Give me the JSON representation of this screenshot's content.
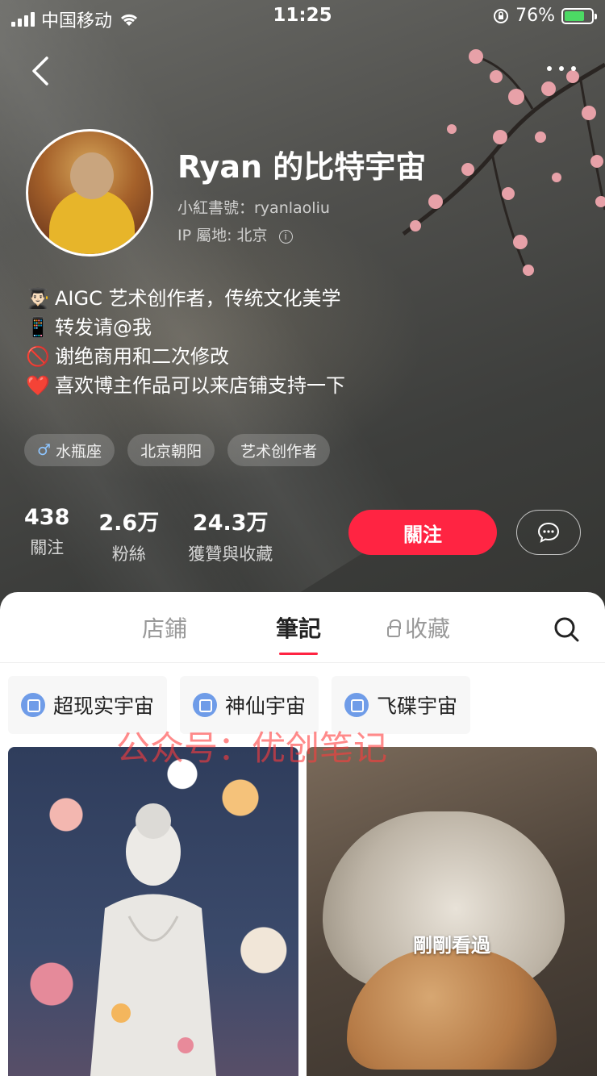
{
  "status_bar": {
    "carrier": "中国移动",
    "time": "11:25",
    "battery_percent": "76%"
  },
  "profile": {
    "name": "Ryan 的比特宇宙",
    "red_id": "小紅書號：ryanlaoliu",
    "ip_location": "IP 屬地: 北京",
    "bio": [
      {
        "icon": "👨🏻‍🎓",
        "text": "AIGC 艺术创作者，传统文化美学"
      },
      {
        "icon": "📱",
        "text": "转发请@我"
      },
      {
        "icon": "🚫",
        "text": "谢绝商用和二次修改"
      },
      {
        "icon": "❤️",
        "text": "喜欢博主作品可以来店铺支持一下"
      }
    ],
    "tags": [
      "水瓶座",
      "北京朝阳",
      "艺术创作者"
    ],
    "stats": [
      {
        "value": "438",
        "label": "關注"
      },
      {
        "value": "2.6万",
        "label": "粉絲"
      },
      {
        "value": "24.3万",
        "label": "獲贊與收藏"
      }
    ],
    "follow_label": "關注"
  },
  "tabs": {
    "store": "店鋪",
    "notes": "筆記",
    "collections": "收藏"
  },
  "collections_chips": [
    "超现实宇宙",
    "神仙宇宙",
    "飞碟宇宙"
  ],
  "watermark": "公众号：优创笔记",
  "cards": {
    "recently_viewed": "剛剛看過"
  },
  "colors": {
    "accent": "#ff2442",
    "chip_icon": "#6f9ce8"
  }
}
